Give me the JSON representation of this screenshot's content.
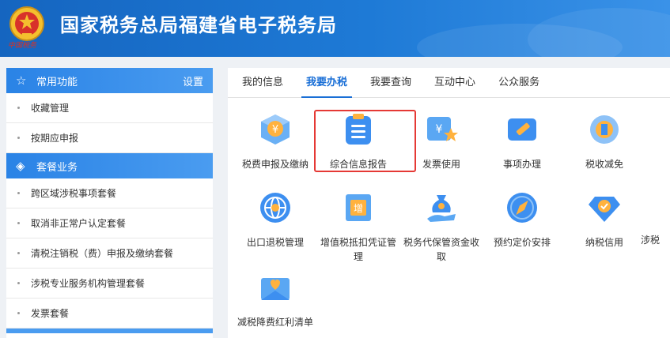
{
  "header": {
    "title": "国家税务总局福建省电子税务局",
    "emblem_text": "中国税务",
    "emblem_icon": "tax-emblem-icon"
  },
  "sidebar": {
    "sections": [
      {
        "title": "常用功能",
        "icon": "star-icon",
        "extra": "设置",
        "items": [
          "收藏管理",
          "按期应申报"
        ]
      },
      {
        "title": "套餐业务",
        "icon": "layers-icon",
        "items": [
          "跨区域涉税事项套餐",
          "取消非正常户认定套餐",
          "清税注销税（费）申报及缴纳套餐",
          "涉税专业服务机构管理套餐",
          "发票套餐"
        ]
      }
    ]
  },
  "tabs": [
    "我的信息",
    "我要办税",
    "我要查询",
    "互动中心",
    "公众服务"
  ],
  "active_tab": "我要办税",
  "services": [
    {
      "label": "税费申报及缴纳",
      "icon": "yuan-box-icon"
    },
    {
      "label": "综合信息报告",
      "icon": "clipboard-icon",
      "highlighted": true
    },
    {
      "label": "发票使用",
      "icon": "invoice-icon"
    },
    {
      "label": "事项办理",
      "icon": "pen-ticket-icon"
    },
    {
      "label": "税收减免",
      "icon": "tax-cut-icon"
    },
    {
      "label": "出口退税管理",
      "icon": "globe-icon"
    },
    {
      "label": "增值税抵扣凭证管理",
      "icon": "vat-invoice-icon"
    },
    {
      "label": "税务代保管资金收取",
      "icon": "money-bag-hand-icon"
    },
    {
      "label": "预约定价安排",
      "icon": "compass-icon"
    },
    {
      "label": "纳税信用",
      "icon": "diamond-check-icon"
    },
    {
      "label": "涉税",
      "icon": "partial-icon"
    },
    {
      "label": "减税降费红利清单",
      "icon": "heart-envelope-icon"
    }
  ],
  "colors": {
    "header": "#1e7ad6",
    "accent": "#1a6fd6",
    "highlight": "#e53935"
  }
}
